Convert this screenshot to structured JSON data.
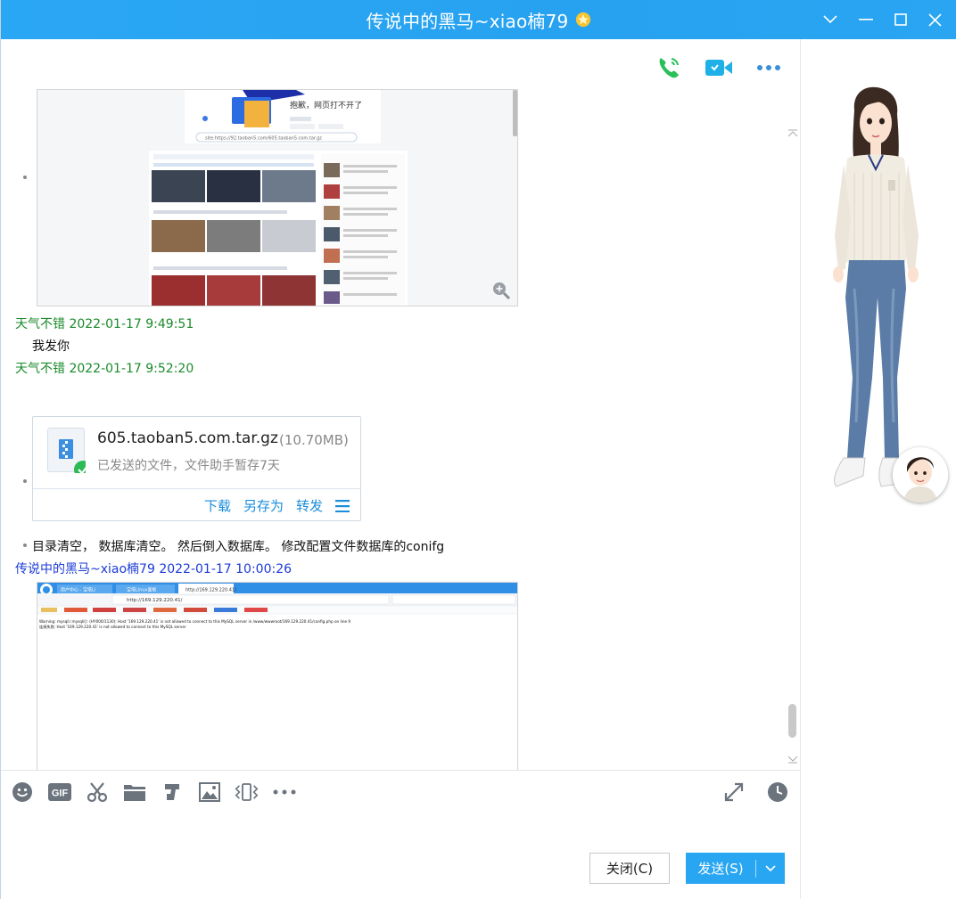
{
  "window": {
    "title": "传说中的黑马~xiao楠79",
    "controls": {
      "dropdown": "﹀",
      "minimize": "—",
      "maximize": "☐",
      "close": "✕"
    }
  },
  "colors": {
    "titlebar": "#2aa7f4",
    "sender_self": "#1a8a2a",
    "sender_other": "#1c3bd6",
    "link": "#1a8ddb",
    "send_button": "#29a6f1"
  },
  "top_toolbar": {
    "icons": [
      "phone-icon",
      "video-call-icon",
      "more-icon"
    ]
  },
  "messages": [
    {
      "type": "image",
      "desc_icon": "screenshot-thumbnail",
      "zoom_icon": "zoom-in-icon"
    },
    {
      "type": "header",
      "sender": "天气不错",
      "time": "2022-01-17 9:49:51"
    },
    {
      "type": "text",
      "text": "我发你"
    },
    {
      "type": "header",
      "sender": "天气不错",
      "time": "2022-01-17 9:52:20"
    },
    {
      "type": "file",
      "file_name": "605.taoban5.com.tar.gz",
      "file_size": "(10.70MB)",
      "status": "已发送的文件，文件助手暂存7天",
      "actions": {
        "download": "下载",
        "save_as": "另存为",
        "forward": "转发"
      }
    },
    {
      "type": "text",
      "text": "目录清空， 数据库清空。 然后倒入数据库。 修改配置文件数据库的conifg"
    },
    {
      "type": "header",
      "sender": "传说中的黑马~xiao楠79",
      "time": "2022-01-17 10:00:26"
    },
    {
      "type": "image",
      "desc_icon": "browser-screenshot"
    }
  ],
  "screenshot1": {
    "error_title": "抱歉，网页打不开了",
    "url": "site:https://92.taoban5.com/605.taoban5.com.tar.gz"
  },
  "screenshot2": {
    "tab1": "用户中心 - 宝塔Li",
    "tab2": "宝塔Linux面板",
    "tab3": "http://169.129.220.41/",
    "address": "http://169.129.220.41/",
    "warning": "Warning: mysqli::mysqli(): (HY000/1130): Host '169.129.220.41' is not allowed to connect to this MySQL server in /www/wwwroot/169.129.220.41/config.php on line 9",
    "error_line": "连接失败: Host '169.129.220.41' is not allowed to connect to this MySQL server"
  },
  "input_toolbar": {
    "gif_label": "GIF",
    "icons": [
      "emoji-icon",
      "gif-icon",
      "scissors-icon",
      "folder-icon",
      "music-icon",
      "image-icon",
      "shake-icon",
      "more-icon"
    ],
    "right_icons": [
      "expand-icon",
      "history-icon"
    ]
  },
  "buttons": {
    "close": "关闭(C)",
    "send": "发送(S)"
  }
}
